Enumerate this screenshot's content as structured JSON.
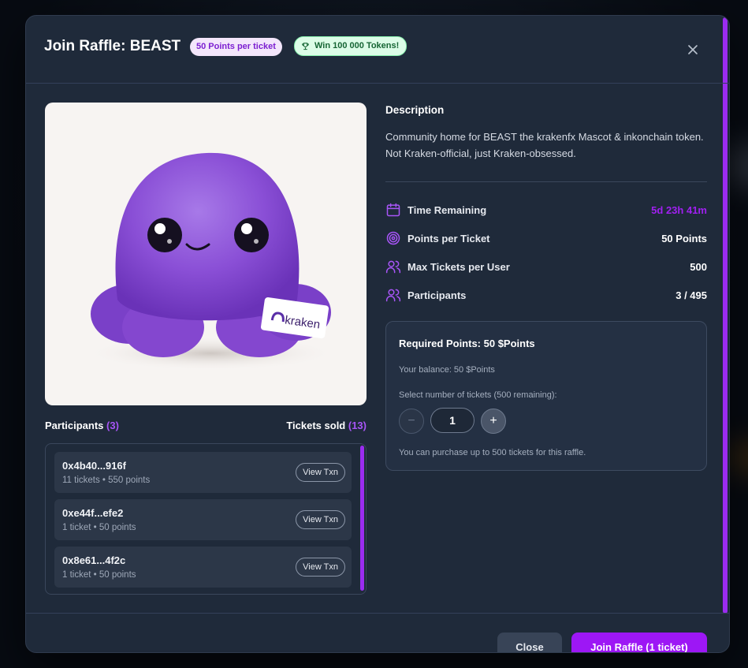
{
  "modal": {
    "title": "Join Raffle: BEAST",
    "badge_points": "50 Points per ticket",
    "badge_win": "Win 100 000 Tokens!",
    "close_icon": "close-icon"
  },
  "image": {
    "brand_tag": "kraken",
    "subject": "purple-octopus-plush"
  },
  "participants": {
    "label": "Participants",
    "count": "(3)",
    "tickets_label": "Tickets sold",
    "tickets_count": "(13)",
    "rows": [
      {
        "address": "0x4b40...916f",
        "meta": "11 tickets • 550 points",
        "action": "View Txn"
      },
      {
        "address": "0xe44f...efe2",
        "meta": "1 ticket • 50 points",
        "action": "View Txn"
      },
      {
        "address": "0x8e61...4f2c",
        "meta": "1 ticket • 50 points",
        "action": "View Txn"
      }
    ]
  },
  "description": {
    "title": "Description",
    "text": "Community home for BEAST the krakenfx Mascot & inkonchain token. Not Kraken-official, just Kraken-obsessed."
  },
  "stats": [
    {
      "icon": "calendar-icon",
      "label": "Time Remaining",
      "value": "5d 23h 41m",
      "highlight": true
    },
    {
      "icon": "target-icon",
      "label": "Points per Ticket",
      "value": "50 Points",
      "highlight": false
    },
    {
      "icon": "users-icon",
      "label": "Max Tickets per User",
      "value": "500",
      "highlight": false
    },
    {
      "icon": "users-icon",
      "label": "Participants",
      "value": "3 / 495",
      "highlight": false
    }
  ],
  "purchase": {
    "title": "Required Points: 50 $Points",
    "balance": "Your balance: 50 $Points",
    "select_label": "Select number of tickets (500 remaining):",
    "quantity": "1",
    "minus": "−",
    "plus": "+",
    "note": "You can purchase up to 500 tickets for this raffle."
  },
  "footer": {
    "close_label": "Close",
    "join_label": "Join Raffle (1 ticket)"
  },
  "colors": {
    "accent": "#9d17f5",
    "modal_bg": "#1f2a3a",
    "badge_points_bg": "#f3e6fb",
    "badge_win_bg": "#dcfce7"
  }
}
